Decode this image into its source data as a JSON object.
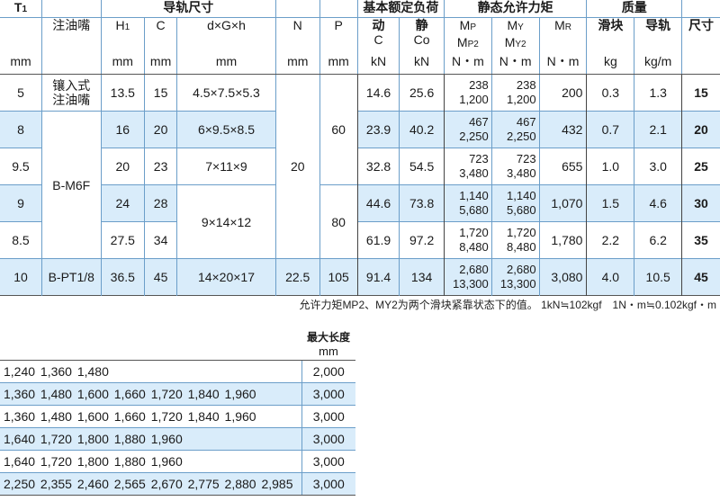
{
  "spec_table": {
    "group_rail": "导轨尺寸",
    "group_load": "基本额定负荷",
    "group_moment": "静态允许力矩",
    "group_mass": "质量",
    "h_T1": "T",
    "h_T1_sub": "1",
    "h_nozzle": "注油嘴",
    "h_H1": "H",
    "h_H1_sub": "1",
    "h_C": "C",
    "h_dGh": "d×G×h",
    "h_N": "N",
    "h_P": "P",
    "h_dyn": "动",
    "h_dyn_sym": "C",
    "h_sta": "静",
    "h_sta_sym": "Co",
    "h_MP": "M",
    "h_MP_sub": "P",
    "h_MP2": "M",
    "h_MP2_sub": "P2",
    "h_MY": "M",
    "h_MY_sub": "Y",
    "h_MY2": "M",
    "h_MY2_sub": "Y2",
    "h_MR": "M",
    "h_MR_sub": "R",
    "h_block": "滑块",
    "h_rail": "导轨",
    "h_size": "尺寸",
    "u_mm": "mm",
    "u_kN": "kN",
    "u_Nm": "N・m",
    "u_kg": "kg",
    "u_kgm": "kg/m",
    "rows": [
      {
        "T1": "5",
        "H1": "13.5",
        "C": "15",
        "C_dyn": "14.6",
        "Co": "25.6",
        "MP": "238",
        "MP2": "1,200",
        "MY": "238",
        "MY2": "1,200",
        "MR": "200",
        "block": "0.3",
        "rail": "1.3",
        "size": "15"
      },
      {
        "T1": "8",
        "H1": "16",
        "C": "20",
        "C_dyn": "23.9",
        "Co": "40.2",
        "MP": "467",
        "MP2": "2,250",
        "MY": "467",
        "MY2": "2,250",
        "MR": "432",
        "block": "0.7",
        "rail": "2.1",
        "size": "20"
      },
      {
        "T1": "9.5",
        "H1": "20",
        "C": "23",
        "C_dyn": "32.8",
        "Co": "54.5",
        "MP": "723",
        "MP2": "3,480",
        "MY": "723",
        "MY2": "3,480",
        "MR": "655",
        "block": "1.0",
        "rail": "3.0",
        "size": "25"
      },
      {
        "T1": "9",
        "H1": "24",
        "C": "28",
        "C_dyn": "44.6",
        "Co": "73.8",
        "MP": "1,140",
        "MP2": "5,680",
        "MY": "1,140",
        "MY2": "5,680",
        "MR": "1,070",
        "block": "1.5",
        "rail": "4.6",
        "size": "30"
      },
      {
        "T1": "8.5",
        "H1": "27.5",
        "C": "34",
        "C_dyn": "61.9",
        "Co": "97.2",
        "MP": "1,720",
        "MP2": "8,480",
        "MY": "1,720",
        "MY2": "8,480",
        "MR": "1,780",
        "block": "2.2",
        "rail": "6.2",
        "size": "35"
      },
      {
        "T1": "10",
        "H1": "36.5",
        "C": "45",
        "C_dyn": "91.4",
        "Co": "134",
        "MP": "2,680",
        "MP2": "13,300",
        "MY": "2,680",
        "MY2": "13,300",
        "MR": "3,080",
        "block": "4.0",
        "rail": "10.5",
        "size": "45"
      }
    ],
    "nozzle": [
      "镶入式\n注油嘴",
      "B-M6F",
      "B-PT1/8"
    ],
    "dGh": [
      "4.5×7.5×5.3",
      "6×9.5×8.5",
      "7×11×9",
      "9×14×12",
      "14×20×17"
    ],
    "N": [
      "20",
      "22.5"
    ],
    "P": [
      "60",
      "80",
      "105"
    ]
  },
  "note": "允许力矩MP2、MY2为两个滑块紧靠状态下的值。 1kN≒102kgf　1N・m≒0.102kgf・m",
  "length_table": {
    "max_title": "最大长度",
    "max_unit": "mm",
    "rows": [
      {
        "series": "1,240  1,360  1,480",
        "max": "2,000"
      },
      {
        "series": "1,360  1,480  1,600  1,660  1,720  1,840  1,960",
        "max": "3,000"
      },
      {
        "series": "1,360  1,480  1,600  1,660  1,720  1,840  1,960",
        "max": "3,000"
      },
      {
        "series": "1,640  1,720  1,800  1,880  1,960",
        "max": "3,000"
      },
      {
        "series": "1,640  1,720  1,800  1,880  1,960",
        "max": "3,000"
      },
      {
        "series": "2,250  2,355  2,460  2,565  2,670  2,775  2,880  2,985",
        "max": "3,000"
      }
    ]
  }
}
